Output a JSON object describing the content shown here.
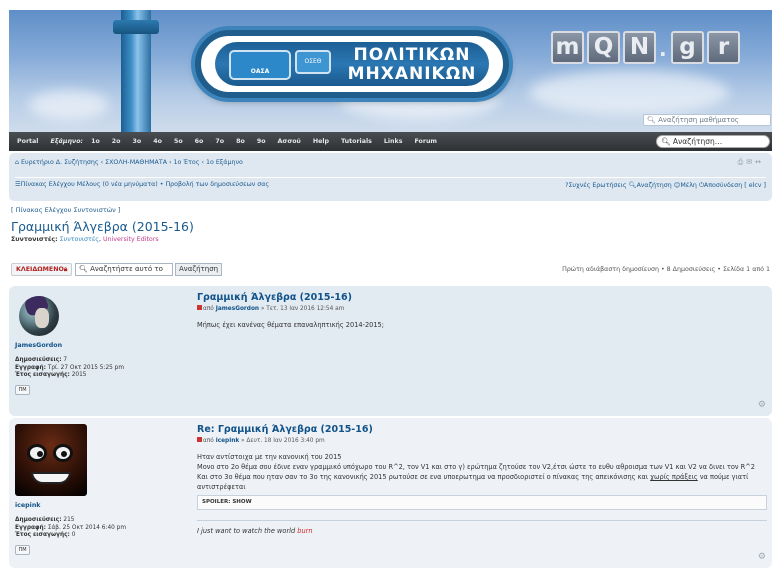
{
  "banner": {
    "sign_text": "ΠΟΛΙΤΙΚΩΝ ΜΗΧΑΝΙΚΩΝ",
    "sign_logo_text": "OΑΣA",
    "sign_logo2_text": "ΟΣΕΘ",
    "logo_letters": [
      "m",
      "Q",
      "N",
      ".",
      "g",
      "r"
    ],
    "course_search_text": "Αναζήτηση μαθήματος"
  },
  "navbar": {
    "items": [
      "Portal",
      "Εξάμηνο:",
      "1ο",
      "2ο",
      "3ο",
      "4ο",
      "5ο",
      "6ο",
      "7ο",
      "8ο",
      "9ο",
      "Ασσού",
      "Help",
      "Tutorials",
      "Links",
      "Forum"
    ],
    "search_placeholder": "Αναζήτηση…"
  },
  "breadcrumbs": {
    "trail": "Ευρετήριο Δ. Συζήτησης ‹ ΣΧΟΛΗ-ΜΑΘΗΜΑΤΑ ‹ 1ο Έτος ‹ 1ο Εξάμηνο",
    "ucp": "Πίνακας Ελέγχου Μέλους (0 νέα μηνύματα) • Προβολή των δημοσιεύσεων σας",
    "right_links": [
      "Συχνές Ερωτήσεις",
      "Αναζήτηση",
      "Μέλη",
      "Αποσύνδεση [ elcv ]"
    ]
  },
  "mcp_link": "[ Πίνακας Ελέγχου Συντονιστών ]",
  "topic": {
    "title": "Γραμμική Άλγεβρα (2015-16)",
    "moderators_label": "Συντονιστές:",
    "moderator_name": "Συντονιστές",
    "moderator_group": "University Editors"
  },
  "actions": {
    "locked_label": "ΚΛΕΙΔΩΜΕΝΟ",
    "search_placeholder": "Αναζητήστε αυτό το",
    "search_button": "Αναζήτηση",
    "pagination": "Πρώτη αδιάβαστη δημοσίευση • 8 Δημοσιεύσεις • Σελίδα 1 από 1"
  },
  "posts": [
    {
      "title": "Γραμμική Άλγεβρα (2015-16)",
      "author_prefix": "από",
      "author": "JamesGordon",
      "date": "» Τετ. 13 Ιαν 2016 12:54 am",
      "content": [
        "Μήπως έχει κανένας θέματα επαναληπτικής 2014-2015;"
      ],
      "username": "JamesGordon",
      "posts_label": "Δημοσιεύσεις:",
      "posts_count": "7",
      "joined_label": "Εγγραφή:",
      "joined": "Τρί. 27 Οκτ 2015 5:25 pm",
      "year_label": "Έτος εισαγωγής:",
      "year": "2015",
      "pm_label": "ΠΜ"
    },
    {
      "title": "Re: Γραμμική Άλγεβρα (2015-16)",
      "author_prefix": "από",
      "author": "icepink",
      "date": "» Δευτ. 18 Ιαν 2016 3:40 pm",
      "content": [
        "Ηταν αντίστοιχα με την κανονική του 2015",
        "Μονο στο 2ο θέμα σου έδινε εναν γραμμικό υπόχωρο του R^2, τον V1 και στο γ) ερώτημα ζητούσε τον V2,έτσι ώστε το ευθυ αθροισμα των V1 και V2 να δινει τον R^2",
        "Και στο 3ο θέμα που ηταν σαν το 3ο της κανονικής 2015 ρωτούσε σε ενα υποερωτημα να προσδιοριστεί ο πίνακας της απεικόνισης και"
      ],
      "content_underlined": "χωρίς πράξεις",
      "content_tail": "να πούμε γιατί αντιστρέφεται",
      "spoiler": "SPOILER: SHOW",
      "signature_prefix": "I just want to watch the world",
      "signature_burn": "burn",
      "username": "icepink",
      "posts_label": "Δημοσιεύσεις:",
      "posts_count": "215",
      "joined_label": "Εγγραφή:",
      "joined": "Σάβ. 25 Οκτ 2014 6:40 pm",
      "year_label": "Έτος εισαγωγής:",
      "year": "0",
      "pm_label": "ΠΜ"
    }
  ]
}
